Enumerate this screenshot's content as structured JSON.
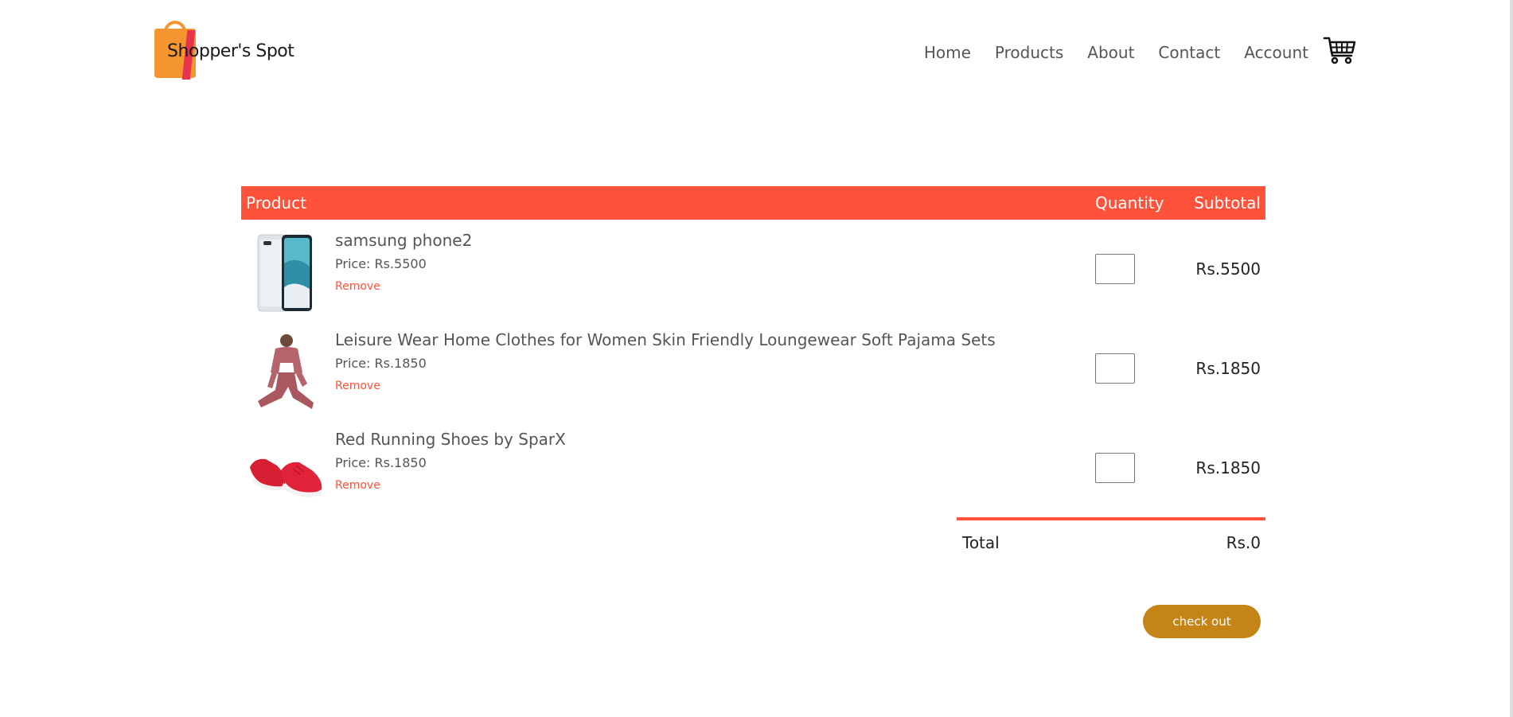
{
  "brand": {
    "logo_text": "Shopper's Spot"
  },
  "nav": {
    "items": [
      {
        "label": "Home"
      },
      {
        "label": "Products"
      },
      {
        "label": "About"
      },
      {
        "label": "Contact"
      },
      {
        "label": "Account"
      }
    ],
    "cart_icon": "cart-icon"
  },
  "cart": {
    "headers": {
      "product": "Product",
      "quantity": "Quantity",
      "subtotal": "Subtotal"
    },
    "items": [
      {
        "name": "samsung phone2",
        "price": "Price: Rs.5500",
        "remove": "Remove",
        "quantity": "",
        "subtotal": "Rs.5500",
        "image": "phone-image"
      },
      {
        "name": "Leisure Wear Home Clothes for Women Skin Friendly Loungewear Soft Pajama Sets",
        "price": "Price: Rs.1850",
        "remove": "Remove",
        "quantity": "",
        "subtotal": "Rs.1850",
        "image": "pajama-set-image"
      },
      {
        "name": "Red Running Shoes by SparX",
        "price": "Price: Rs.1850",
        "remove": "Remove",
        "quantity": "",
        "subtotal": "Rs.1850",
        "image": "red-shoes-image"
      }
    ],
    "total_label": "Total",
    "total_value": "Rs.0",
    "checkout_label": "check out"
  },
  "colors": {
    "accent": "#ff523b",
    "checkout": "#c48416",
    "text": "#555555"
  }
}
